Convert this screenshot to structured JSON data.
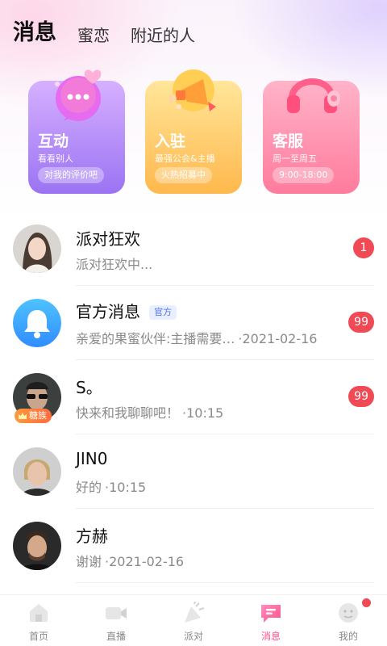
{
  "top_tabs": [
    {
      "label": "消息",
      "active": true
    },
    {
      "label": "蜜恋",
      "active": false
    },
    {
      "label": "附近的人",
      "active": false
    }
  ],
  "cards": [
    {
      "title": "互动",
      "subtitle": "看看别人",
      "pill": "对我的评价吧",
      "icon": "chat-bubble-icon"
    },
    {
      "title": "入驻",
      "subtitle": "最强公会&主播",
      "pill": "火热招募中",
      "icon": "megaphone-icon"
    },
    {
      "title": "客服",
      "subtitle": "周一至周五",
      "pill": "9:00-18:00",
      "icon": "headphones-icon"
    }
  ],
  "messages": [
    {
      "name": "派对狂欢",
      "preview": "派对狂欢中...",
      "time": "",
      "badge": "1"
    },
    {
      "name": "官方消息",
      "tag": "官方",
      "preview": "亲爱的果蜜伙伴:主播需要…",
      "time": "·2021-02-16",
      "badge": "99"
    },
    {
      "name": "S。",
      "preview": "快来和我聊聊吧！",
      "time": "·10:15",
      "badge": "99",
      "level_badge": "糖族"
    },
    {
      "name": "JIN0",
      "preview": "好的",
      "time": "·10:15",
      "badge": ""
    },
    {
      "name": "方赫",
      "preview": "谢谢",
      "time": "·2021-02-16",
      "badge": ""
    }
  ],
  "bottom_nav": [
    {
      "label": "首页",
      "icon": "home-icon",
      "active": false
    },
    {
      "label": "直播",
      "icon": "video-camera-icon",
      "active": false
    },
    {
      "label": "派对",
      "icon": "party-icon",
      "active": false
    },
    {
      "label": "消息",
      "icon": "message-icon",
      "active": true
    },
    {
      "label": "我的",
      "icon": "profile-icon",
      "active": false,
      "dot": true
    }
  ],
  "colors": {
    "accent": "#ff4f8a",
    "badge_red": "#f04a55",
    "official_blue": "#4d73e6"
  }
}
